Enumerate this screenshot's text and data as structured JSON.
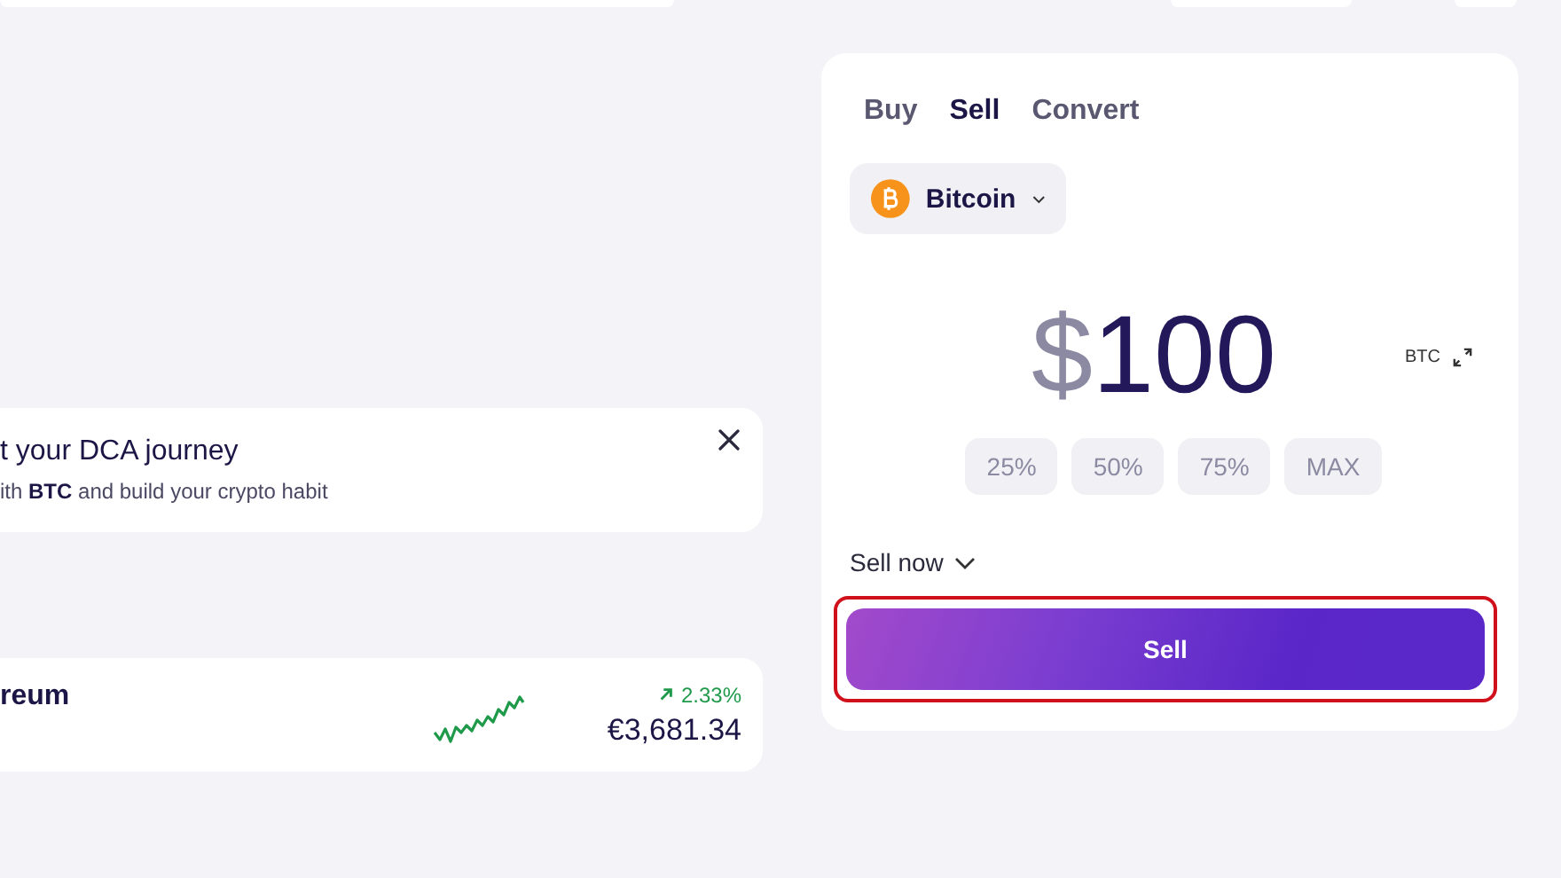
{
  "banner": {
    "title": "t your DCA journey",
    "text": "ith **BTC** and build your crypto habit"
  },
  "asset_row": {
    "name": "reum",
    "rising": true,
    "change": "2.33%",
    "price": "€3,681.34"
  },
  "trade_panel": {
    "tabs": [
      {
        "label": "Buy",
        "selected": false
      },
      {
        "label": "Sell",
        "selected": true
      },
      {
        "label": "Convert",
        "selected": false
      }
    ],
    "asset": {
      "name": "Bitcoin"
    },
    "amount": {
      "currency_symbol": "$",
      "value": "100"
    },
    "unit_toggle": "BTC",
    "presets": [
      "25%",
      "50%",
      "75%",
      "MAX"
    ],
    "timing": "Sell now",
    "action": {
      "label": "Sell",
      "highlighted": true
    }
  }
}
